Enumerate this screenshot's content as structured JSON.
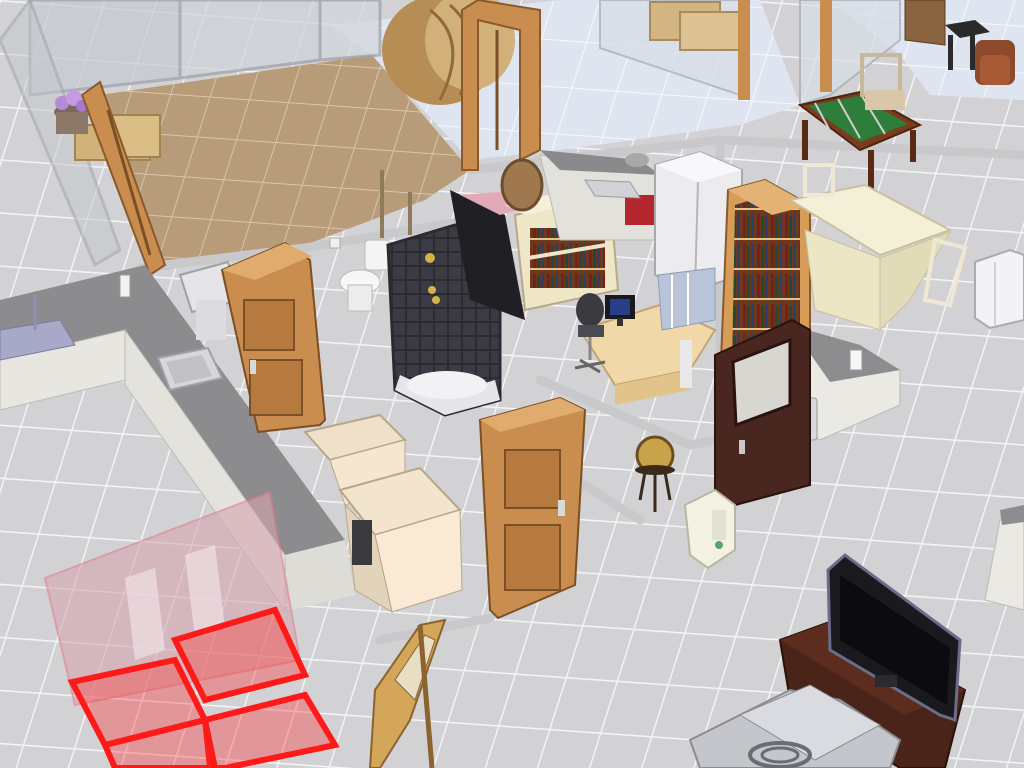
{
  "view": {
    "mode": "build-buy",
    "camera": "isometric-overhead"
  },
  "palette": {
    "tile_light": "#d3d3d5",
    "tile_grout": "#f2f2f4",
    "wood_floor": "#b59a78",
    "ghost_blue": "#e6ecf6",
    "door_wood": "#c98d4f",
    "door_dark": "#4a2620",
    "placement_invalid": "#ff1a1a"
  },
  "objects": [
    {
      "name": "hay-bale",
      "count": 4
    },
    {
      "name": "flower-pot",
      "count": 1
    },
    {
      "name": "interior-door",
      "count": 2
    },
    {
      "name": "dark-door-with-glass",
      "count": 1
    },
    {
      "name": "kitchen-counter",
      "count": 3
    },
    {
      "name": "sink",
      "count": 2
    },
    {
      "name": "toilet",
      "count": 1
    },
    {
      "name": "corner-shower",
      "count": 1
    },
    {
      "name": "bookshelf",
      "count": 2
    },
    {
      "name": "computer-desk",
      "count": 1
    },
    {
      "name": "office-chair",
      "count": 1
    },
    {
      "name": "refrigerator",
      "count": 2
    },
    {
      "name": "foosball-table",
      "count": 1
    },
    {
      "name": "dining-table",
      "count": 1
    },
    {
      "name": "dining-chair",
      "count": 3
    },
    {
      "name": "washer-dryer",
      "count": 1
    },
    {
      "name": "world-globe",
      "count": 1
    },
    {
      "name": "air-conditioner",
      "count": 1
    },
    {
      "name": "flat-screen-tv",
      "count": 1
    },
    {
      "name": "tv-stand",
      "count": 1
    },
    {
      "name": "stove",
      "count": 1
    },
    {
      "name": "easel",
      "count": 1
    },
    {
      "name": "trash-can",
      "count": 1
    },
    {
      "name": "end-table",
      "count": 1
    },
    {
      "name": "armchair",
      "count": 1
    },
    {
      "name": "ghost-window-placement",
      "count": 1
    }
  ]
}
